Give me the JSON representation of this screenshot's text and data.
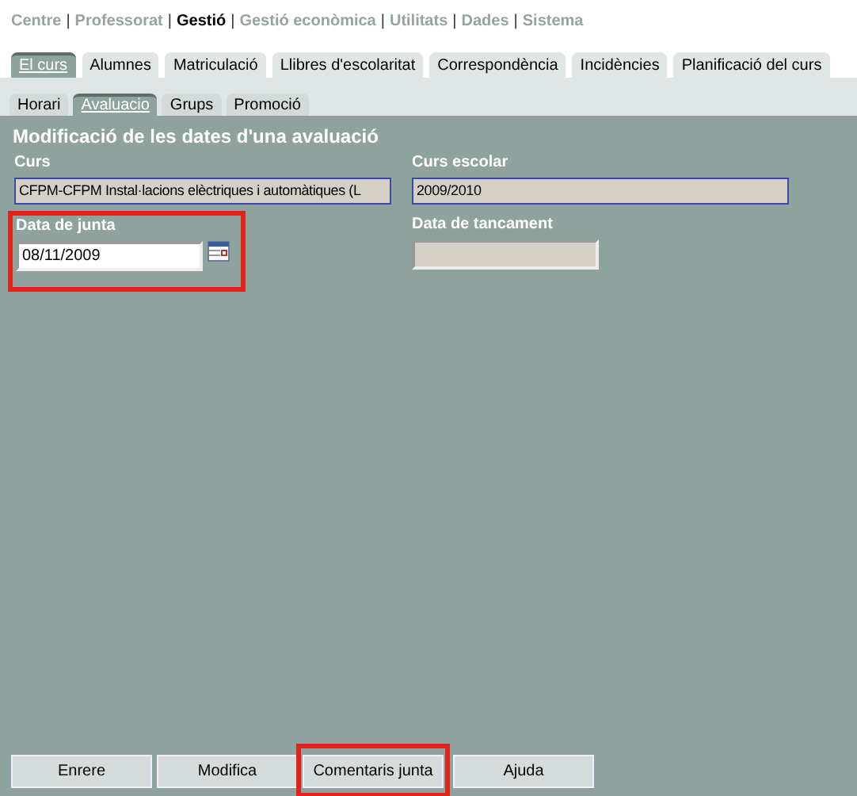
{
  "top_menu": {
    "separator": "|",
    "items": [
      {
        "label": "Centre",
        "selected": false
      },
      {
        "label": "Professorat",
        "selected": false
      },
      {
        "label": "Gestió",
        "selected": true
      },
      {
        "label": "Gestió econòmica",
        "selected": false
      },
      {
        "label": "Utilitats",
        "selected": false
      },
      {
        "label": "Dades",
        "selected": false
      },
      {
        "label": "Sistema",
        "selected": false
      }
    ]
  },
  "tabs": [
    {
      "label": "El curs",
      "selected": true
    },
    {
      "label": "Alumnes",
      "selected": false
    },
    {
      "label": "Matriculació",
      "selected": false
    },
    {
      "label": "Llibres d'escolaritat",
      "selected": false
    },
    {
      "label": "Correspondència",
      "selected": false
    },
    {
      "label": "Incidències",
      "selected": false
    },
    {
      "label": "Planificació del curs",
      "selected": false
    }
  ],
  "subtabs": [
    {
      "label": "Horari",
      "selected": false
    },
    {
      "label": "Avaluacio",
      "selected": true
    },
    {
      "label": "Grups",
      "selected": false
    },
    {
      "label": "Promoció",
      "selected": false
    }
  ],
  "form": {
    "title": "Modificació de les dates d'una avaluació",
    "fields": [
      {
        "label": "Curs",
        "value": "CFPM-CFPM Instal·lacions elèctriques i automàtiques (L",
        "disabled": true,
        "highlighted": false,
        "calendar": false,
        "kind": "wide"
      },
      {
        "label": "Curs escolar",
        "value": "2009/2010",
        "disabled": true,
        "highlighted": false,
        "calendar": false,
        "kind": "wide"
      },
      {
        "label": "Data de junta",
        "value": "08/11/2009",
        "disabled": false,
        "highlighted": true,
        "calendar": true,
        "kind": "short"
      },
      {
        "label": "Data de tancament",
        "disabled": true,
        "highlighted": false,
        "calendar": false,
        "kind": "short"
      }
    ]
  },
  "buttons": [
    {
      "label": "Enrere",
      "highlighted": false
    },
    {
      "label": "Modifica",
      "highlighted": false
    },
    {
      "label": "Comentaris junta",
      "highlighted": true
    },
    {
      "label": "Ajuda",
      "highlighted": false
    }
  ]
}
